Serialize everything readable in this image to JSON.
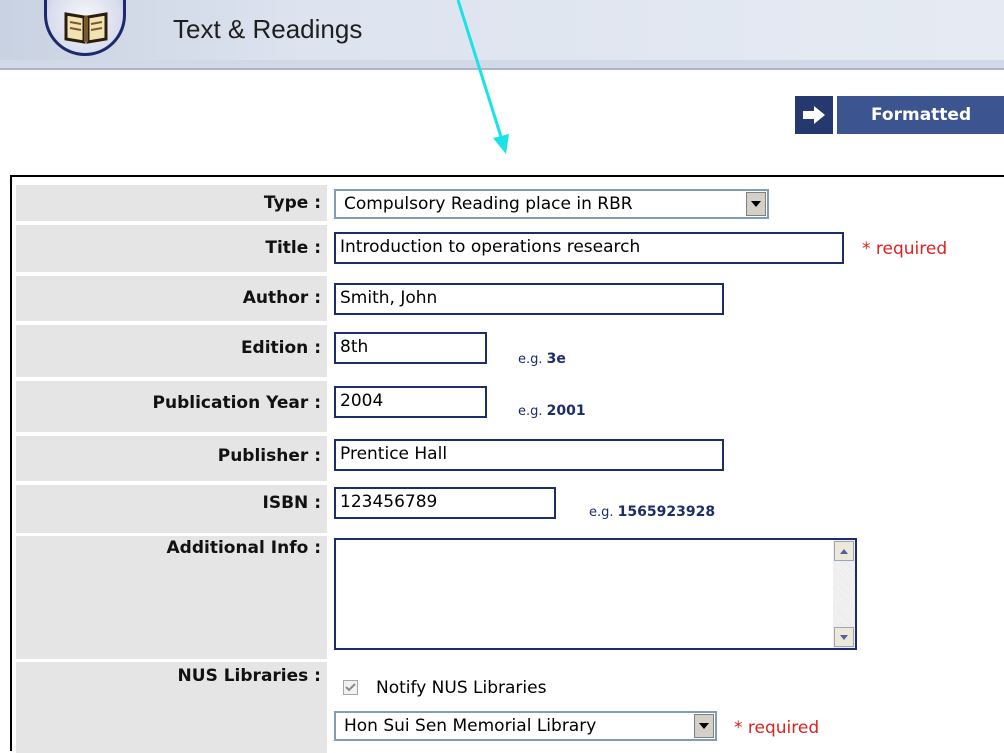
{
  "header": {
    "title": "Text & Readings"
  },
  "toolbar": {
    "formatted_label": "Formatted"
  },
  "form": {
    "type": {
      "label": "Type :",
      "value": "Compulsory Reading place in RBR"
    },
    "title": {
      "label": "Title :",
      "value": "Introduction to operations research",
      "required_text": "* required"
    },
    "author": {
      "label": "Author :",
      "value": "Smith, John"
    },
    "edition": {
      "label": "Edition :",
      "value": "8th",
      "hint_prefix": "e.g. ",
      "hint_example": "3e"
    },
    "year": {
      "label": "Publication Year :",
      "value": "2004",
      "hint_prefix": "e.g. ",
      "hint_example": "2001"
    },
    "publisher": {
      "label": "Publisher :",
      "value": "Prentice Hall"
    },
    "isbn": {
      "label": "ISBN :",
      "value": "123456789",
      "hint_prefix": "e.g. ",
      "hint_example": "1565923928"
    },
    "additional": {
      "label": "Additional Info :",
      "value": ""
    },
    "libraries": {
      "label": "NUS Libraries :",
      "notify_label": "Notify NUS Libraries",
      "notify_checked": true,
      "library_value": "Hon Sui Sen Memorial Library",
      "required_text": "* required"
    }
  },
  "colors": {
    "accent": "#3c5590",
    "required": "#e22020",
    "label_bg": "#e5e5e5",
    "hint": "#1c2d6a",
    "annotation_arrow": "#19e3e8"
  },
  "icons": [
    "book-icon",
    "arrow-right-icon",
    "chevron-down-icon",
    "scroll-up-icon",
    "scroll-down-icon",
    "checkmark-icon"
  ]
}
